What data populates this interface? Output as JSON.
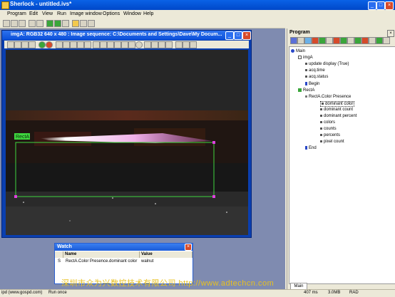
{
  "app": {
    "title": "Sherlock - untitled.ivs*"
  },
  "menu": [
    "Program",
    "Edit",
    "View",
    "Run",
    "Image window",
    "Options",
    "Window",
    "Help"
  ],
  "image_window": {
    "title": "imgA: RGB32 640 x 480 : Image sequence: C:\\Documents and Settings\\Dave\\My Docum...",
    "roi_label": "RectA"
  },
  "watch": {
    "title": "Watch",
    "col_name": "Name",
    "col_value": "Value",
    "row_type": "S",
    "row_name": "RectA.Color Presence.dominant color",
    "row_value": "walnut"
  },
  "program": {
    "label": "Program",
    "nodes": [
      "Main",
      "imgA",
      "update display (True)",
      "acq.time",
      "acq.status",
      "Begin",
      "RectA",
      "RectA.Color Presence",
      "dominant color",
      "dominant count",
      "dominant percent",
      "colors",
      "counts",
      "percents",
      "pixel count",
      "End"
    ],
    "tab": "Main"
  },
  "status": {
    "left": "ipd (www.gospd.com)",
    "run": "Run once",
    "time": "407 ms",
    "mem": "3.0MB",
    "mode": "RAD"
  },
  "watermark": "深圳市众为兴数控技术有限公司  http://www.adtechcn.com",
  "colors": {
    "title_blue": "#0a62e6",
    "roi_green": "#3fd63f",
    "watermark": "#e8c020"
  }
}
